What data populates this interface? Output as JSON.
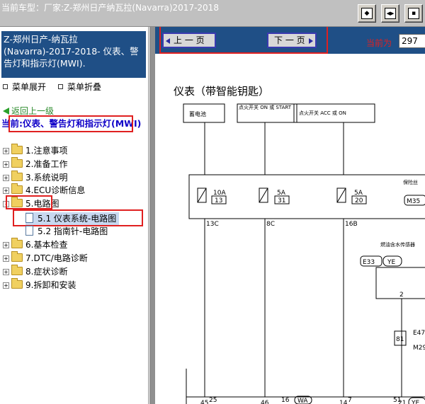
{
  "topbar": {
    "title": "当前车型：厂家:Z-郑州日产纳瓦拉(Navarra)2017-2018",
    "buttons": [
      {
        "icon": "fit-page-icon",
        "glyph": "◆"
      },
      {
        "icon": "double-arrow-icon",
        "glyph": "◀▶"
      },
      {
        "icon": "expand-icon",
        "glyph": "▪"
      }
    ]
  },
  "sidebar": {
    "header": "Z-郑州日产-纳瓦拉(Navarra)-2017-2018- 仪表、警告灯和指示灯(MWI).",
    "expand_label": "菜单展开",
    "collapse_label": "菜单折叠",
    "back_label": "返回上一级",
    "current_label": "当前:仪表、警告灯和指示灯(MWI)",
    "tree": [
      {
        "label": "1.注意事项"
      },
      {
        "label": "2.准备工作"
      },
      {
        "label": "3.系统说明"
      },
      {
        "label": "4.ECU诊断信息"
      },
      {
        "label": "5.电路图"
      },
      {
        "label": "5.1 仪表系统-电路图"
      },
      {
        "label": "5.2 指南针-电路图"
      },
      {
        "label": "6.基本检查"
      },
      {
        "label": "7.DTC/电路诊断"
      },
      {
        "label": "8.症状诊断"
      },
      {
        "label": "9.拆卸和安装"
      }
    ]
  },
  "nav": {
    "prev_label": "上 一 页",
    "next_label": "下 一 页",
    "current_page_label": "当前为",
    "current_page_value": "297"
  },
  "diagram": {
    "title": "仪表（带智能钥匙）",
    "boxes": {
      "battery": "蓄电池",
      "ign_on": "点火开关 ON 或 START",
      "acc_on": "点火开关 ACC 或 ON"
    },
    "fuse_block_label": "保险丝",
    "fuse_block_connector": "M35",
    "fuses": [
      {
        "amp": "10A",
        "num": "13",
        "pin": "13C"
      },
      {
        "amp": "5A",
        "num": "31",
        "pin": "8C"
      },
      {
        "amp": "5A",
        "num": "20",
        "pin": "16B"
      }
    ],
    "module_label": "燃油含水传感器",
    "module_connector": "E33",
    "module_color": "YE",
    "module_pin": "2",
    "joint_num": "81",
    "side_connectors": [
      "E47",
      "M29"
    ],
    "bottom_pins": [
      "45",
      "46",
      "14",
      "21"
    ],
    "bottom_pin_color": "YE",
    "lower_labels": [
      "25",
      "16",
      "WA",
      "7",
      "51"
    ]
  }
}
